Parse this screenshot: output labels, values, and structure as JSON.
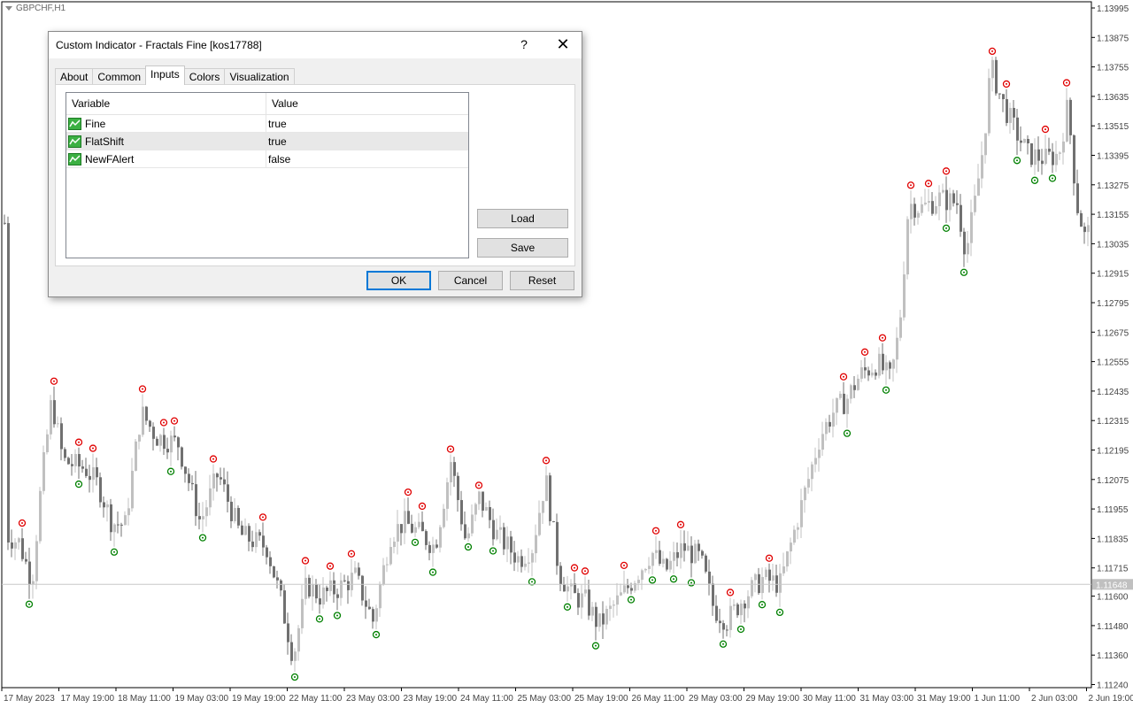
{
  "chart": {
    "symbol": "GBPCHF,H1",
    "current_price_label": "1.11648",
    "price_levels": [
      "1.13995",
      "1.13875",
      "1.13755",
      "1.13635",
      "1.13515",
      "1.13395",
      "1.13275",
      "1.13155",
      "1.13035",
      "1.12915",
      "1.12795",
      "1.12675",
      "1.12555",
      "1.12435",
      "1.12315",
      "1.12195",
      "1.12075",
      "1.11955",
      "1.11835",
      "1.11715",
      "1.11600",
      "1.11480",
      "1.11360",
      "1.11240"
    ],
    "time_labels": [
      "17 May 2023",
      "17 May 19:00",
      "18 May 11:00",
      "19 May 03:00",
      "19 May 19:00",
      "22 May 11:00",
      "23 May 03:00",
      "23 May 19:00",
      "24 May 11:00",
      "25 May 03:00",
      "25 May 19:00",
      "26 May 11:00",
      "29 May 03:00",
      "29 May 19:00",
      "30 May 11:00",
      "31 May 03:00",
      "31 May 19:00",
      "1 Jun 11:00",
      "2 Jun 03:00",
      "2 Jun 19:00"
    ],
    "colors": {
      "bull": "#c0c0c0",
      "bear": "#707070",
      "fractal_up": "#e00000",
      "fractal_down": "#008000",
      "grid_line": "#c8c8c8"
    }
  },
  "dialog": {
    "title": "Custom Indicator - Fractals Fine [kos17788]",
    "help_label": "?",
    "close_label": "✕",
    "tabs": [
      {
        "label": "About"
      },
      {
        "label": "Common"
      },
      {
        "label": "Inputs"
      },
      {
        "label": "Colors"
      },
      {
        "label": "Visualization"
      }
    ],
    "active_tab": "Inputs",
    "table": {
      "headers": {
        "variable": "Variable",
        "value": "Value"
      },
      "rows": [
        {
          "variable": "Fine",
          "value": "true"
        },
        {
          "variable": "FlatShift",
          "value": "true"
        },
        {
          "variable": "NewFAlert",
          "value": "false"
        }
      ]
    },
    "buttons": {
      "load": "Load",
      "save": "Save",
      "ok": "OK",
      "cancel": "Cancel",
      "reset": "Reset"
    }
  }
}
